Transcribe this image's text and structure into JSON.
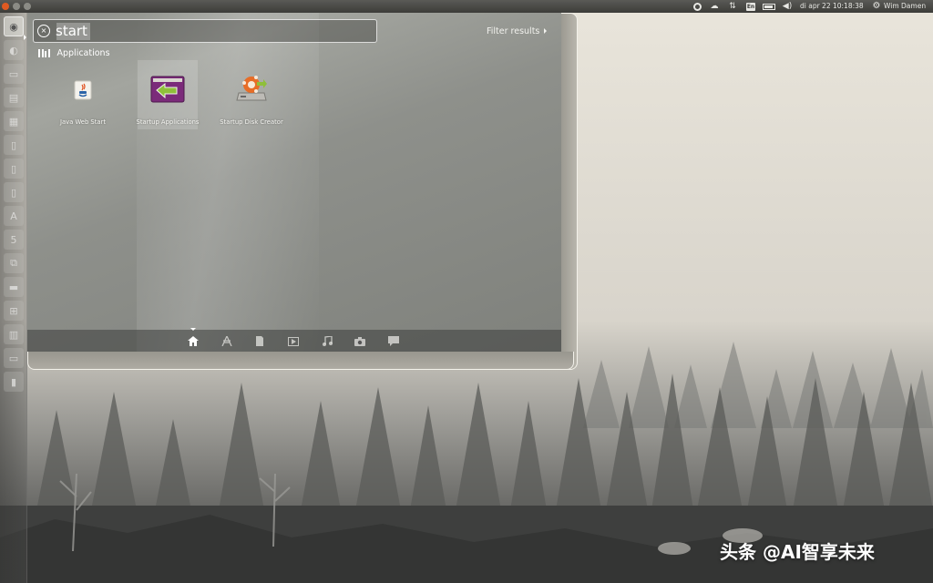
{
  "panel": {
    "clock": "di apr 22 10:18:38",
    "user": "Wim Damen",
    "keyboard_layout": "En"
  },
  "dash": {
    "search": {
      "value": "start",
      "placeholder": ""
    },
    "filter_label": "Filter results",
    "category": "Applications",
    "results": [
      {
        "label": "Java Web Start",
        "icon": "java-icon",
        "selected": false
      },
      {
        "label": "Startup Applications",
        "icon": "startup-applications-icon",
        "selected": true
      },
      {
        "label": "Startup Disk Creator",
        "icon": "startup-disk-creator-icon",
        "selected": false
      }
    ],
    "lenses": [
      {
        "name": "home-lens",
        "icon": "home-icon",
        "active": true
      },
      {
        "name": "applications-lens",
        "icon": "applications-icon",
        "active": false
      },
      {
        "name": "files-lens",
        "icon": "file-icon",
        "active": false
      },
      {
        "name": "video-lens",
        "icon": "video-icon",
        "active": false
      },
      {
        "name": "music-lens",
        "icon": "music-icon",
        "active": false
      },
      {
        "name": "photos-lens",
        "icon": "camera-icon",
        "active": false
      },
      {
        "name": "social-lens",
        "icon": "chat-icon",
        "active": false
      }
    ]
  },
  "launcher": {
    "items": [
      "dash-icon",
      "firefox-icon",
      "terminal-icon",
      "file-manager-icon",
      "writer-icon",
      "calc-icon",
      "impress-icon",
      "software-center-icon",
      "ubuntu-one-icon",
      "settings-icon",
      "window-icon",
      "workspace-switcher-icon",
      "info-icon",
      "mount-icon",
      "trash-icon"
    ]
  },
  "watermark": "头条 @AI智享未来",
  "colors": {
    "accent": "#e05a22",
    "startup_apps_purple": "#7b2b7a",
    "startup_apps_green": "#8fbf3a"
  }
}
